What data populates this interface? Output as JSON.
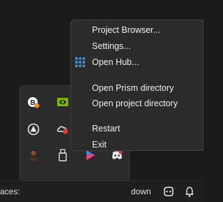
{
  "context_menu": {
    "items": [
      {
        "label": "Project Browser..."
      },
      {
        "label": "Settings..."
      },
      {
        "label": "Open Hub...",
        "icon": "grid-icon"
      },
      {
        "label": "Open Prism directory"
      },
      {
        "label": "Open project directory"
      },
      {
        "label": "Restart"
      },
      {
        "label": "Exit"
      }
    ]
  },
  "taskbar": {
    "left_text": "aces:",
    "right_text": "down"
  },
  "tray": {
    "icons": [
      "b-app-icon",
      "nvidia-icon",
      "prism-icon",
      "cloud-sync-icon",
      "user-icon",
      "usb-drive-icon",
      "color-app-icon",
      "discord-icon",
      "teams-icon"
    ]
  },
  "colors": {
    "menu_bg": "#2b2b2b",
    "accent_blue": "#4a90d9",
    "nvidia_green": "#76b900",
    "notification_red": "#e33b2e",
    "discord_blurple": "#5865f2"
  }
}
